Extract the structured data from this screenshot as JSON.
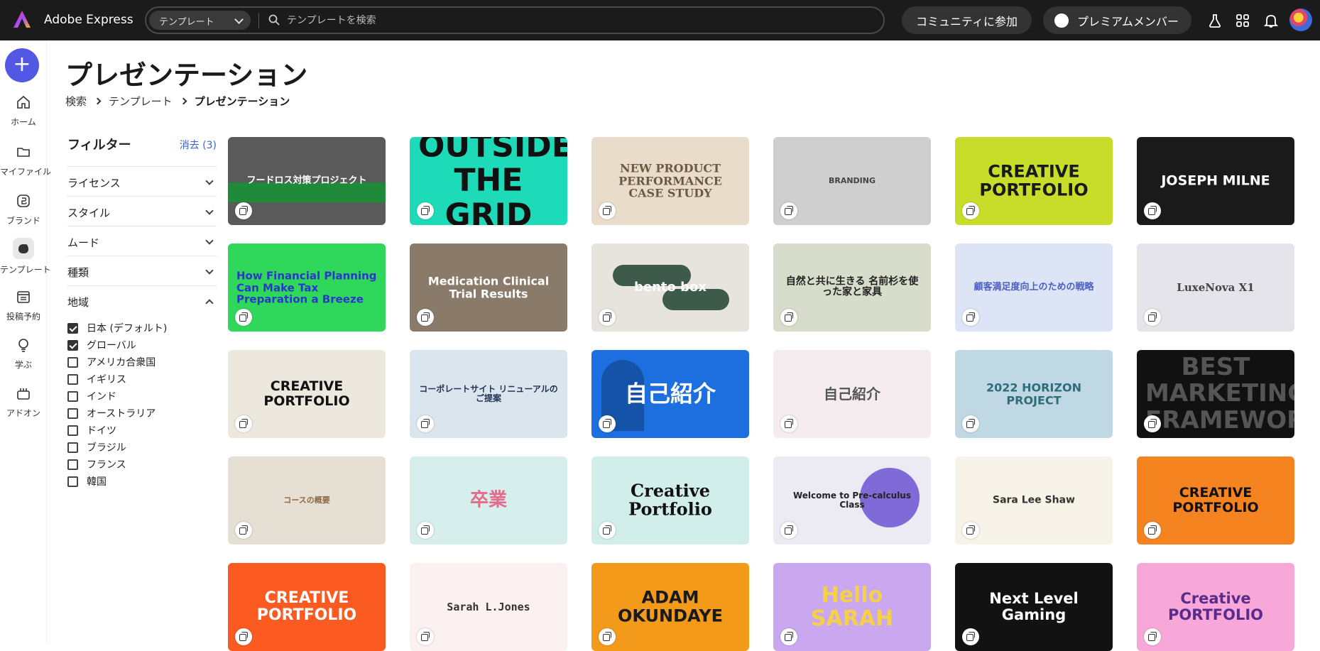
{
  "app": {
    "name": "Adobe Express"
  },
  "search": {
    "scope": "テンプレート",
    "placeholder": "テンプレートを検索"
  },
  "header_actions": {
    "community": "コミュニティに参加",
    "premium": "プレミアムメンバー"
  },
  "rail": {
    "items": [
      {
        "label": "ホーム",
        "icon": "home-icon"
      },
      {
        "label": "マイファイル",
        "icon": "folder-icon"
      },
      {
        "label": "ブランド",
        "icon": "brand-icon"
      },
      {
        "label": "テンプレート",
        "icon": "templates-icon"
      },
      {
        "label": "投稿予約",
        "icon": "calendar-icon"
      },
      {
        "label": "学ぶ",
        "icon": "lightbulb-icon"
      },
      {
        "label": "アドオン",
        "icon": "addons-icon"
      }
    ]
  },
  "page": {
    "title": "プレゼンテーション"
  },
  "breadcrumb": {
    "items": [
      "検索",
      "テンプレート",
      "プレゼンテーション"
    ]
  },
  "filters": {
    "title": "フィルター",
    "clear": "消去 (3)",
    "facets": [
      "ライセンス",
      "スタイル",
      "ムード",
      "種類",
      "地域"
    ],
    "region_options": [
      {
        "label": "日本 (デフォルト)",
        "checked": true
      },
      {
        "label": "グローバル",
        "checked": true
      },
      {
        "label": "アメリカ合衆国",
        "checked": false
      },
      {
        "label": "イギリス",
        "checked": false
      },
      {
        "label": "インド",
        "checked": false
      },
      {
        "label": "オーストラリア",
        "checked": false
      },
      {
        "label": "ドイツ",
        "checked": false
      },
      {
        "label": "ブラジル",
        "checked": false
      },
      {
        "label": "フランス",
        "checked": false
      },
      {
        "label": "韓国",
        "checked": false
      }
    ]
  },
  "templates": [
    {
      "title": "フードロス対策プロジェクト",
      "bg": "#5a5a5a",
      "fg": "#ffffff",
      "style": "food"
    },
    {
      "title": "OUTSIDE THE GRID",
      "bg": "#1ddbb8",
      "fg": "#111111",
      "style": "outside"
    },
    {
      "title": "NEW PRODUCT PERFORMANCE CASE STUDY",
      "bg": "#e9dccb",
      "fg": "#6b5a40",
      "style": "serif"
    },
    {
      "title": "BRANDING",
      "bg": "#cfcfcf",
      "fg": "#444444",
      "style": "mockup"
    },
    {
      "title": "CREATIVE PORTFOLIO",
      "bg": "#c7dd2a",
      "fg": "#1a1a1a",
      "style": "boxed"
    },
    {
      "title": "JOSEPH MILNE",
      "bg": "#1a1a1a",
      "fg": "#ffffff",
      "style": "dark"
    },
    {
      "title": "How Financial Planning Can Make Tax Preparation a Breeze",
      "bg": "#2fd85a",
      "fg": "#2a37c9",
      "style": "left"
    },
    {
      "title": "Medication Clinical Trial Results",
      "bg": "#8a7a6a",
      "fg": "#ffffff",
      "style": "photo"
    },
    {
      "title": "bento box",
      "bg": "#e7e3dd",
      "fg": "#ffffff",
      "style": "bento"
    },
    {
      "title": "自然と共に生きる 名前杉を使った家と家具",
      "bg": "#d8dccb",
      "fg": "#222222",
      "style": "landscape"
    },
    {
      "title": "顧客満足度向上のための戦略",
      "bg": "#dde4f5",
      "fg": "#4b5fc4",
      "style": "blueprint"
    },
    {
      "title": "LuxeNova X1",
      "bg": "#e4e4ea",
      "fg": "#444444",
      "style": "phone"
    },
    {
      "title": "CREATIVE PORTFOLIO",
      "bg": "#ece8dd",
      "fg": "#111111",
      "style": "plain"
    },
    {
      "title": "コーポレートサイト リニューアルのご提案",
      "bg": "#dbe5ee",
      "fg": "#223355",
      "style": "mountains"
    },
    {
      "title": "自己紹介",
      "bg": "#1d6fe0",
      "fg": "#ffffff",
      "style": "blue"
    },
    {
      "title": "自己紹介",
      "bg": "#f4ecef",
      "fg": "#555555",
      "style": "soft"
    },
    {
      "title": "2022 HORIZON PROJECT",
      "bg": "#bfd8e4",
      "fg": "#2f6b7a",
      "style": "horizon"
    },
    {
      "title": "BEST MARKETING FRAMEWORKS",
      "bg": "#111111",
      "fg": "#555555",
      "style": "marketing"
    },
    {
      "title": "コースの概要",
      "bg": "#e6dfd3",
      "fg": "#8a6b45",
      "style": "course"
    },
    {
      "title": "卒業",
      "bg": "#d7efec",
      "fg": "#e46b8a",
      "style": "graduation"
    },
    {
      "title": "Creative Portfolio",
      "bg": "#d2eeea",
      "fg": "#111111",
      "style": "eyes"
    },
    {
      "title": "Welcome to Pre-calculus Class",
      "bg": "#ecebf4",
      "fg": "#222222",
      "style": "precalc"
    },
    {
      "title": "Sara Lee Shaw",
      "bg": "#f7f3e9",
      "fg": "#333333",
      "style": "shaw"
    },
    {
      "title": "CREATIVE PORTFOLIO",
      "bg": "#f5831f",
      "fg": "#111111",
      "style": "orange"
    },
    {
      "title": "CREATIVE PORTFOLIO",
      "bg": "#fb5a21",
      "fg": "#ffffff",
      "style": "blob"
    },
    {
      "title": "Sarah L.Jones",
      "bg": "#fbf1f1",
      "fg": "#333333",
      "style": "grid"
    },
    {
      "title": "ADAM OKUNDAYE",
      "bg": "#f39a1a",
      "fg": "#1a1a1a",
      "style": "adam"
    },
    {
      "title": "Hello SARAH",
      "bg": "#c9a8f0",
      "fg": "#f7d04a",
      "style": "sarah"
    },
    {
      "title": "Next Level Gaming",
      "bg": "#121212",
      "fg": "#ffffff",
      "style": "gaming"
    },
    {
      "title": "Creative PORTFOLIO",
      "bg": "#f7a8d8",
      "fg": "#5a2b8a",
      "style": "colorful"
    }
  ],
  "colors": {
    "accent": "#5258e4",
    "link": "#3b63d9",
    "topbar": "#1b1b1b"
  }
}
